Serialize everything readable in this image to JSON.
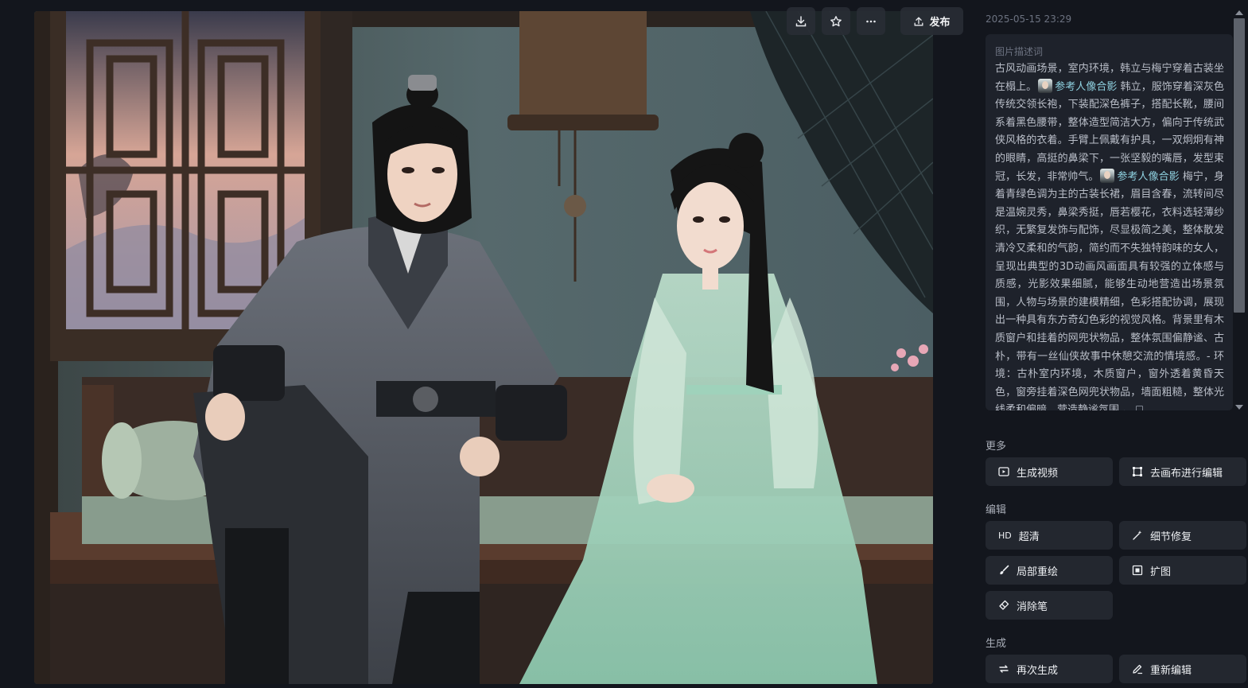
{
  "toolbar": {
    "download_icon": "download-icon",
    "favorite_icon": "star-icon",
    "more_icon": "more-icon",
    "publish_label": "发布"
  },
  "meta": {
    "timestamp": "2025-05-15 23:29"
  },
  "description": {
    "label": "图片描述词",
    "part1": "古风动画场景，室内环境，韩立与梅宁穿着古装坐在榻上。",
    "ref1": "参考人像合影",
    "part2": " 韩立，服饰穿着深灰色传统交领长袍，下装配深色裤子，搭配长靴，腰间系着黑色腰带，整体造型简洁大方，偏向于传统武侠风格的衣着。手臂上佩戴有护具，一双炯炯有神的眼睛，高挺的鼻梁下，一张坚毅的嘴唇，发型束冠，长发，非常帅气。",
    "ref2": "参考人像合影",
    "part3": " 梅宁，身着青绿色调为主的古装长裙，眉目含春，流转间尽是温婉灵秀，鼻梁秀挺，唇若樱花，衣料选轻薄纱织，无繁复发饰与配饰，尽显极简之美，整体散发清冷又柔和的气韵，简约而不失独特韵味的女人，呈现出典型的3D动画风画面具有较强的立体感与质感，光影效果细腻，能够生动地营造出场景氛围，人物与场景的建模精细，色彩搭配协调，展现出一种具有东方奇幻色彩的视觉风格。背景里有木质窗户和挂着的网兜状物品，整体氛围偏静谧、古朴，带有一丝仙侠故事中休憩交流的情境感。- 环境：古朴室内环境，木质窗户，窗外透着黄昏天色，窗旁挂着深色网兜状物品，墙面粗糙，整体光线柔和偏暗，营造静谧氛围 。"
  },
  "sections": {
    "more": {
      "title": "更多",
      "generate_video": "生成视频",
      "canvas_edit": "去画布进行编辑"
    },
    "edit": {
      "title": "编辑",
      "hd_badge": "HD",
      "hd": "超清",
      "detail_fix": "细节修复",
      "inpaint": "局部重绘",
      "outpaint": "扩图",
      "eraser": "消除笔"
    },
    "generate": {
      "title": "生成",
      "regenerate": "再次生成",
      "reedit": "重新编辑"
    }
  }
}
